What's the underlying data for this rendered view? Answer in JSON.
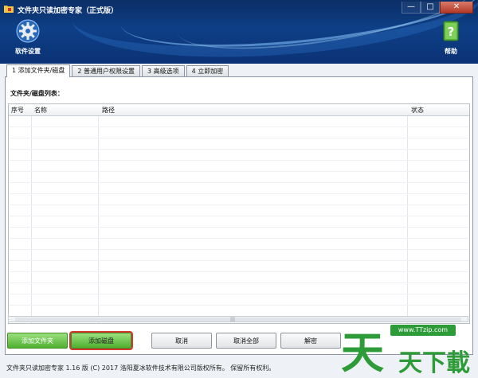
{
  "window": {
    "title": "文件夹只读加密专家（正式版）",
    "controls": [
      "—",
      "□",
      "✕"
    ]
  },
  "header": {
    "settings_label": "软件设置",
    "help_label": "帮助"
  },
  "tabs": [
    {
      "label": "1 添加文件夹/磁盘",
      "active": true
    },
    {
      "label": "2 普通用户权限设置",
      "active": false
    },
    {
      "label": "3 高级选项",
      "active": false
    },
    {
      "label": "4 立即加密",
      "active": false
    }
  ],
  "main": {
    "list_label": "文件夹/磁盘列表：",
    "columns": [
      "序号",
      "名称",
      "路径",
      "状态"
    ],
    "rows": []
  },
  "buttons": {
    "add_folder": "添加文件夹",
    "add_disk": "添加磁盘",
    "cancel": "取消",
    "cancel_all": "取消全部",
    "decrypt": "解密"
  },
  "status_bar": "文件夹只读加密专家 1.16 版 (C) 2017 洛阳夏冰软件技术有限公司版权所有。 保留所有权利。",
  "watermark": {
    "url": "www.TTzip.com",
    "text": "天天下載"
  },
  "colors": {
    "title_bar": "#0e3f86",
    "green_button": "#4fb030",
    "highlight_outline": "#d33a2e"
  }
}
